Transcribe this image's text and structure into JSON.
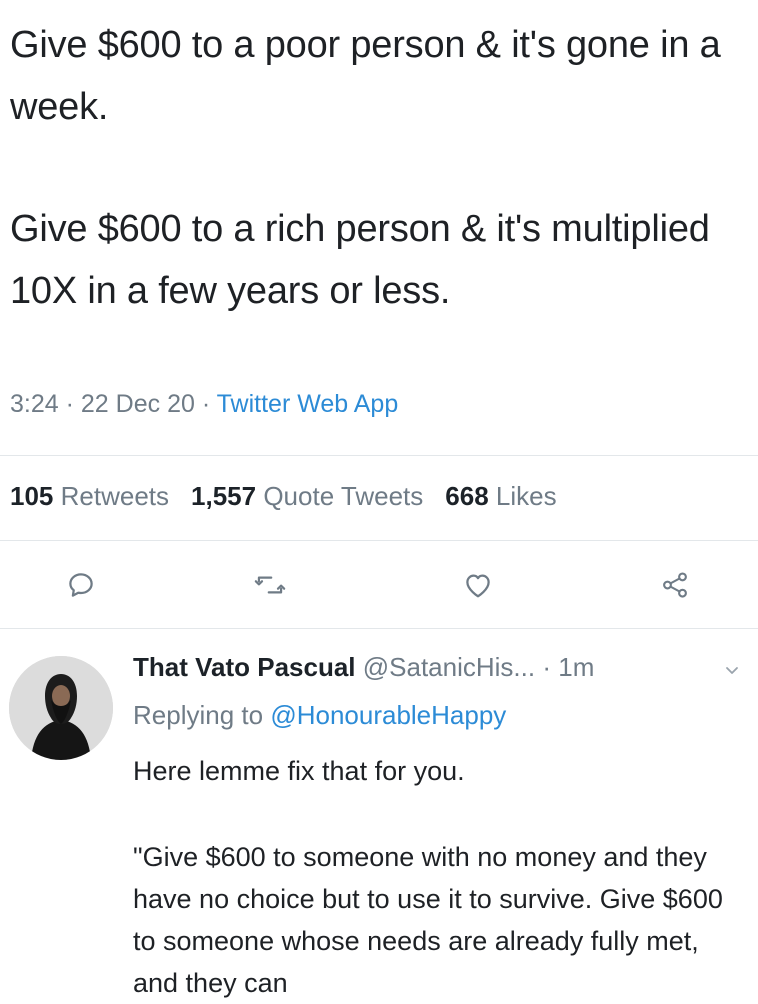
{
  "tweet": {
    "paragraph_1": "Give $600 to a poor person & it's gone in a week.",
    "paragraph_2": "Give $600 to a rich person & it's multiplied 10X in a few years or less.",
    "time": "3:24",
    "separator": "·",
    "date": "22 Dec 20",
    "source": "Twitter Web App"
  },
  "stats": {
    "retweets_count": "105",
    "retweets_label": "Retweets",
    "quote_count": "1,557",
    "quote_label": "Quote Tweets",
    "likes_count": "668",
    "likes_label": "Likes"
  },
  "actions": {
    "icons": [
      "reply-icon",
      "retweet-icon",
      "like-icon",
      "share-icon"
    ],
    "color": "#6f7b86"
  },
  "reply": {
    "author_name": "That Vato Pascual",
    "author_handle": "@SatanicHis...",
    "separator": "·",
    "time_ago": "1m",
    "replying_prefix": "Replying to",
    "replying_handle": "@HonourableHappy",
    "line_1": "Here lemme fix that for you.",
    "line_2": "\"Give $600 to someone with no money and they have no choice but to use it to survive. Give $600 to someone whose needs are already fully met, and they can"
  },
  "colors": {
    "text": "#1c2228",
    "muted": "#6f7b86",
    "link": "#2c8bd6",
    "divider": "#e3e7ea"
  }
}
